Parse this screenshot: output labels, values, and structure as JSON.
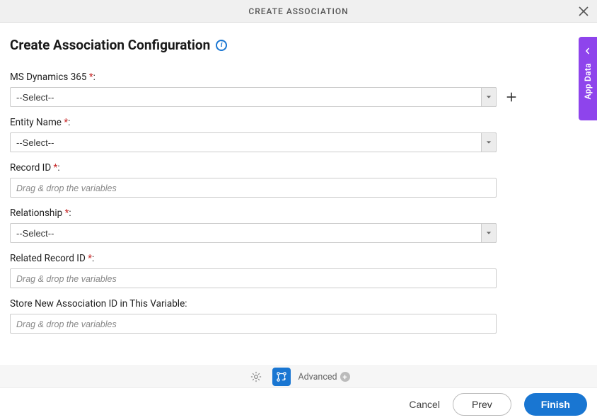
{
  "titlebar": {
    "title": "CREATE ASSOCIATION"
  },
  "page": {
    "heading": "Create Association Configuration"
  },
  "fields": {
    "dynamics": {
      "label": "MS Dynamics 365 ",
      "required": "*",
      "colon": ":",
      "value": "--Select--"
    },
    "entity": {
      "label": "Entity Name ",
      "required": "*",
      "colon": ":",
      "value": "--Select--"
    },
    "recordId": {
      "label": "Record ID ",
      "required": "*",
      "colon": ":",
      "placeholder": "Drag & drop the variables"
    },
    "relationship": {
      "label": "Relationship ",
      "required": "*",
      "colon": ":",
      "value": "--Select--"
    },
    "relatedRecordId": {
      "label": "Related Record ID ",
      "required": "*",
      "colon": ":",
      "placeholder": "Drag & drop the variables"
    },
    "storeVar": {
      "label": "Store New Association ID in This Variable:",
      "placeholder": "Drag & drop the variables"
    }
  },
  "sideTab": {
    "label": "App Data"
  },
  "toolbar": {
    "advanced": "Advanced"
  },
  "footer": {
    "cancel": "Cancel",
    "prev": "Prev",
    "finish": "Finish"
  }
}
